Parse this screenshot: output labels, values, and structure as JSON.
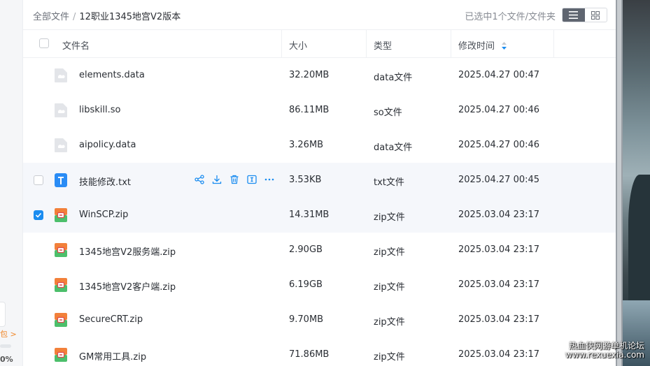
{
  "breadcrumb": {
    "root": "全部文件",
    "separator": "/",
    "current": "12职业1345地宫V2版本"
  },
  "selection_info": "已选中1个文件/文件夹",
  "columns": {
    "name": "文件名",
    "size": "大小",
    "type": "类型",
    "modified": "修改时间"
  },
  "files": [
    {
      "name": "elements.data",
      "size": "32.20MB",
      "type": "data文件",
      "modified": "2025.04.27 00:47",
      "icon": "generic-file-icon"
    },
    {
      "name": "libskill.so",
      "size": "86.11MB",
      "type": "so文件",
      "modified": "2025.04.27 00:46",
      "icon": "generic-file-icon"
    },
    {
      "name": "aipolicy.data",
      "size": "3.26MB",
      "type": "data文件",
      "modified": "2025.04.27 00:46",
      "icon": "generic-file-icon"
    },
    {
      "name": "技能修改.txt",
      "size": "3.53KB",
      "type": "txt文件",
      "modified": "2025.04.27 00:45",
      "icon": "txt-file-icon",
      "state": "hover"
    },
    {
      "name": "WinSCP.zip",
      "size": "14.31MB",
      "type": "zip文件",
      "modified": "2025.03.04 23:17",
      "icon": "zip-file-icon",
      "state": "selected"
    },
    {
      "name": "1345地宫V2服务端.zip",
      "size": "2.90GB",
      "type": "zip文件",
      "modified": "2025.03.04 23:17",
      "icon": "zip-file-icon"
    },
    {
      "name": "1345地宫V2客户端.zip",
      "size": "6.19GB",
      "type": "zip文件",
      "modified": "2025.03.04 23:17",
      "icon": "zip-file-icon"
    },
    {
      "name": "SecureCRT.zip",
      "size": "9.70MB",
      "type": "zip文件",
      "modified": "2025.03.04 23:17",
      "icon": "zip-file-icon"
    },
    {
      "name": "GM常用工具.zip",
      "size": "71.86MB",
      "type": "zip文件",
      "modified": "2025.03.04 23:17",
      "icon": "zip-file-icon"
    }
  ],
  "row_actions": [
    "share-icon",
    "download-icon",
    "delete-icon",
    "rename-icon",
    "more-icon"
  ],
  "sidebar_fragment": {
    "orange_text": "包 >",
    "percent_text": "0%"
  },
  "watermark": {
    "line1": "热血侠网游单机论坛",
    "line2": "www.rexuexia.com"
  },
  "colors": {
    "accent": "#1a8cf0",
    "selected_row_bg": "#f5f7fb",
    "zip_icon_orange": "#f2803a",
    "zip_icon_green": "#4cbf6b"
  }
}
